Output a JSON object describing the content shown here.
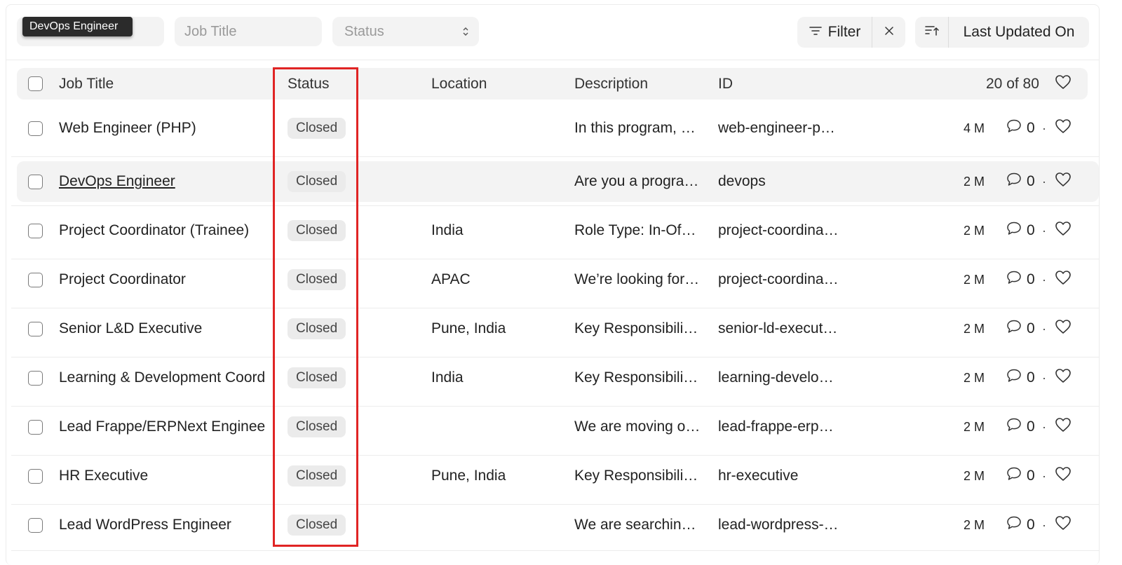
{
  "tooltip": {
    "text": "DevOps Engineer"
  },
  "filters": {
    "name_placeholder": "",
    "job_title_placeholder": "Job Title",
    "status_placeholder": "Status",
    "filter_label": "Filter",
    "sort_label": "Last Updated On"
  },
  "table": {
    "columns": {
      "title": "Job Title",
      "status": "Status",
      "location": "Location",
      "description": "Description",
      "id": "ID"
    },
    "count": "20 of 80",
    "rows": [
      {
        "title": "Web Engineer (PHP)",
        "status": "Closed",
        "location": "",
        "description": "In this program, …",
        "id": "web-engineer-p…",
        "updated": "4 M",
        "comments": "0"
      },
      {
        "title": "DevOps Engineer",
        "status": "Closed",
        "location": "",
        "description": "Are you a progra…",
        "id": "devops",
        "updated": "2 M",
        "comments": "0"
      },
      {
        "title": "Project Coordinator (Trainee)",
        "status": "Closed",
        "location": "India",
        "description": "Role Type: In-Of…",
        "id": "project-coordina…",
        "updated": "2 M",
        "comments": "0"
      },
      {
        "title": "Project Coordinator",
        "status": "Closed",
        "location": "APAC",
        "description": "We’re looking for…",
        "id": "project-coordina…",
        "updated": "2 M",
        "comments": "0"
      },
      {
        "title": "Senior L&D Executive",
        "status": "Closed",
        "location": "Pune, India",
        "description": "Key Responsibili…",
        "id": "senior-ld-execut…",
        "updated": "2 M",
        "comments": "0"
      },
      {
        "title": "Learning & Development Coord",
        "status": "Closed",
        "location": "India",
        "description": "Key Responsibili…",
        "id": "learning-develo…",
        "updated": "2 M",
        "comments": "0"
      },
      {
        "title": "Lead Frappe/ERPNext Enginee",
        "status": "Closed",
        "location": "",
        "description": "We are moving o…",
        "id": "lead-frappe-erp…",
        "updated": "2 M",
        "comments": "0"
      },
      {
        "title": "HR Executive",
        "status": "Closed",
        "location": "Pune, India",
        "description": "Key Responsibili…",
        "id": "hr-executive",
        "updated": "2 M",
        "comments": "0"
      },
      {
        "title": "Lead WordPress Engineer",
        "status": "Closed",
        "location": "",
        "description": "We are searchin…",
        "id": "lead-wordpress-…",
        "updated": "2 M",
        "comments": "0"
      }
    ]
  },
  "colors": {
    "highlight_border": "#e02424",
    "badge_bg": "#ebebeb",
    "input_bg": "#f3f3f3"
  },
  "icons": {
    "filter": "filter-lines-icon",
    "clear": "close-icon",
    "sort": "sort-ascending-icon",
    "comment": "comment-bubble-icon",
    "like": "heart-icon"
  }
}
